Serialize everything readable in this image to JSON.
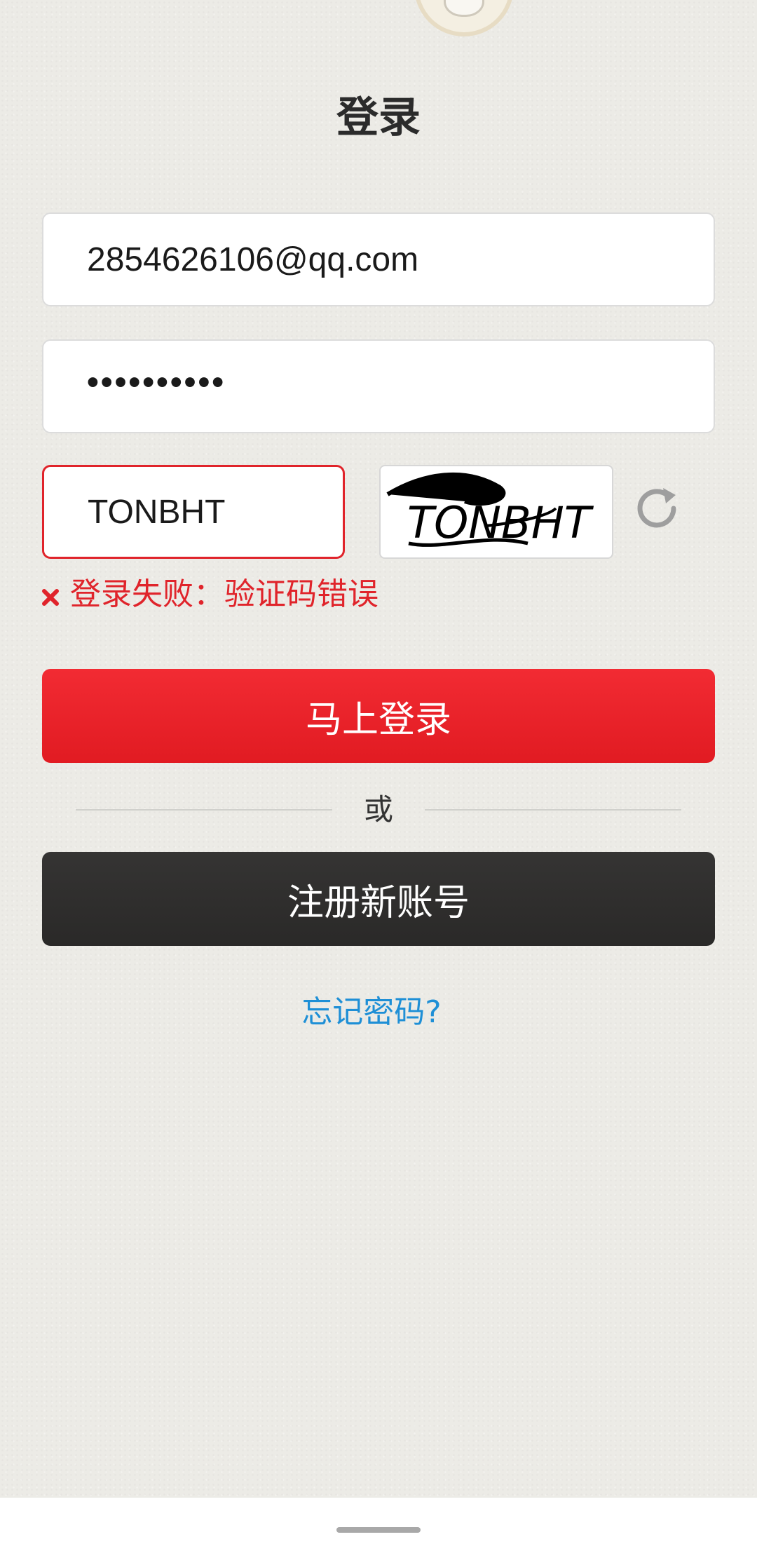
{
  "header": {
    "title": "登录"
  },
  "form": {
    "email_value": "2854626106@qq.com",
    "password_masked": "••••••••••",
    "captcha_value": "TONBHT",
    "captcha_image_text": "TONBHT"
  },
  "error": {
    "message": "登录失败：验证码错误"
  },
  "actions": {
    "login_label": "马上登录",
    "divider_label": "或",
    "register_label": "注册新账号",
    "forgot_label": "忘记密码?"
  },
  "colors": {
    "primary_red": "#e61e25",
    "dark_button": "#2f2e2d",
    "link_blue": "#1e8fd6",
    "background": "#ecebe6"
  },
  "icons": {
    "refresh": "refresh-icon",
    "error": "close-icon"
  }
}
